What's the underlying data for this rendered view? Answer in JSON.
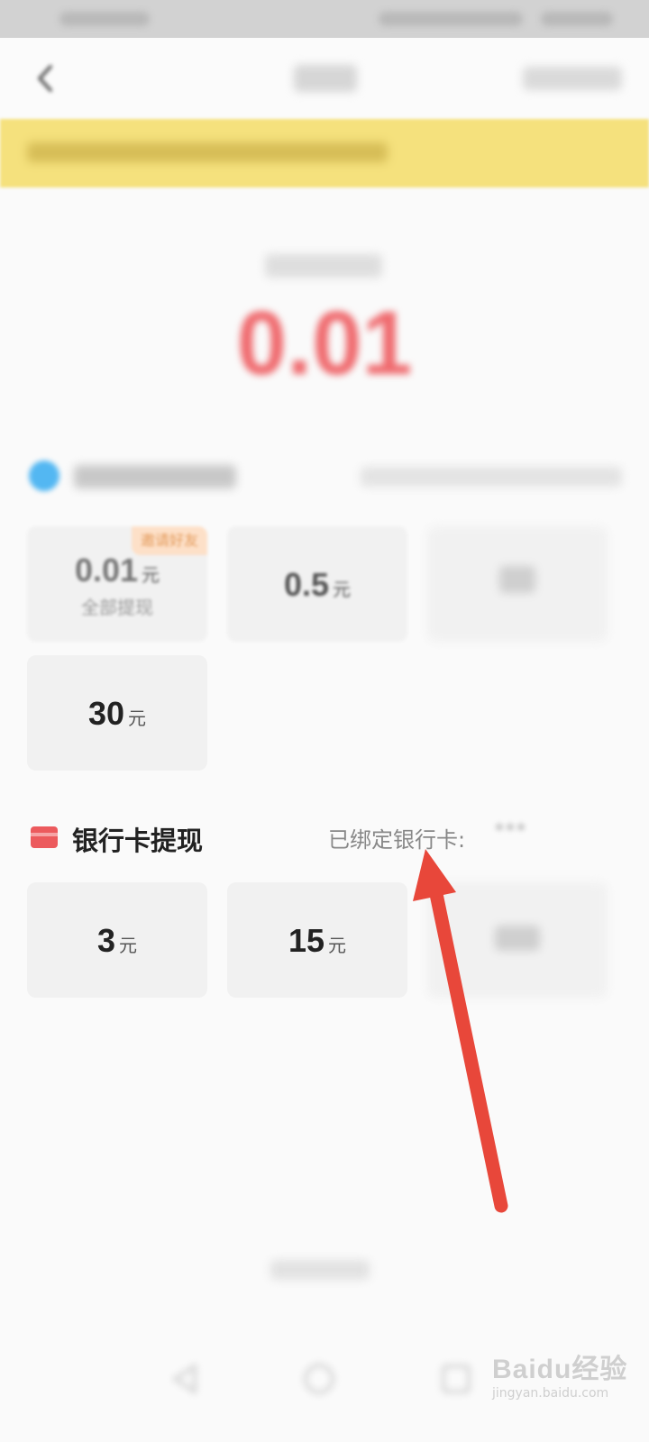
{
  "wechat_options": [
    {
      "amount": "0.01",
      "unit": "元",
      "sub": "全部提现",
      "badge": "邀请好友"
    },
    {
      "amount": "0.5",
      "unit": "元"
    },
    {
      "amount": "30",
      "unit": "元"
    }
  ],
  "bank": {
    "title": "银行卡提现",
    "bound_label": "已绑定银行卡:",
    "masked_card": "***",
    "options": [
      {
        "amount": "3",
        "unit": "元"
      },
      {
        "amount": "15",
        "unit": "元"
      }
    ]
  },
  "balance": {
    "amount": "0.01"
  },
  "watermark": {
    "brand": "Baidu经验",
    "url": "jingyan.baidu.com"
  },
  "colors": {
    "accent_red": "#ec5a5d",
    "notice_yellow": "#f5e17d",
    "wechat_blue": "#53b7f2",
    "annotation_arrow": "#e8473a"
  }
}
